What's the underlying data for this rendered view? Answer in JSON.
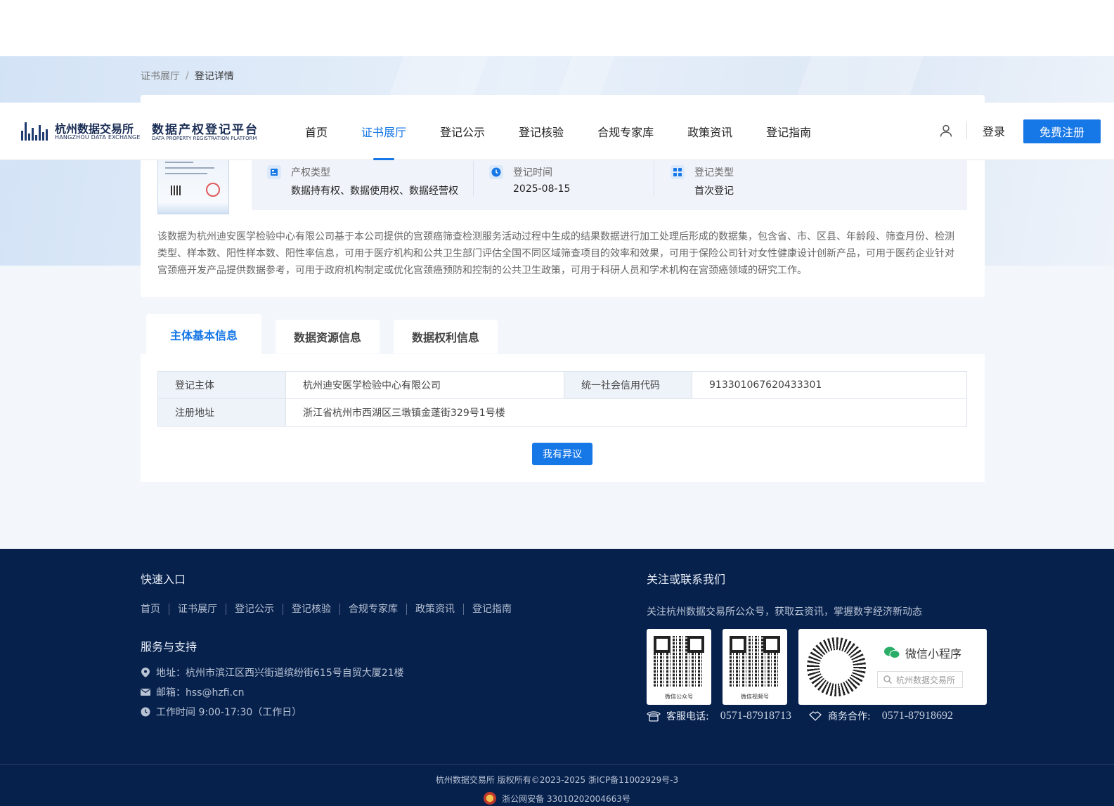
{
  "breadcrumb": {
    "parent": "证书展厅",
    "separator": "/",
    "current": "登记详情"
  },
  "header": {
    "logo_cn": "杭州数据交易所",
    "logo_en": "HANGZHOU DATA EXCHANGE",
    "platform_cn": "数据产权登记平台",
    "platform_en": "DATA PROPERTY REGISTRATION PLATFORM",
    "nav": [
      "首页",
      "证书展厅",
      "登记公示",
      "登记核验",
      "合规专家库",
      "政策资讯",
      "登记指南"
    ],
    "active_nav": "证书展厅",
    "login": "登录",
    "register": "免费注册"
  },
  "detail": {
    "right_type_label": "产权类型",
    "right_type_value": "数据持有权、数据使用权、数据经营权",
    "reg_time_label": "登记时间",
    "reg_time_value": "2025-08-15",
    "reg_kind_label": "登记类型",
    "reg_kind_value": "首次登记",
    "description": "该数据为杭州迪安医学检验中心有限公司基于本公司提供的宫颈癌筛查检测服务活动过程中生成的结果数据进行加工处理后形成的数据集，包含省、市、区县、年龄段、筛查月份、检测类型、样本数、阳性样本数、阳性率信息，可用于医疗机构和公共卫生部门评估全国不同区域筛查项目的效率和效果，可用于保险公司针对女性健康设计创新产品，可用于医药企业针对宫颈癌开发产品提供数据参考，可用于政府机构制定或优化宫颈癌预防和控制的公共卫生政策，可用于科研人员和学术机构在宫颈癌领域的研究工作。"
  },
  "tabs": [
    "主体基本信息",
    "数据资源信息",
    "数据权利信息"
  ],
  "active_tab": "主体基本信息",
  "subject": {
    "entity_label": "登记主体",
    "entity_value": "杭州迪安医学检验中心有限公司",
    "credit_code_label": "统一社会信用代码",
    "credit_code_value": "913301067620433301",
    "address_label": "注册地址",
    "address_value": "浙江省杭州市西湖区三墩镇金蓬街329号1号楼"
  },
  "objection_button": "我有异议",
  "footer": {
    "quick_title": "快速入口",
    "quick_links": [
      "首页",
      "证书展厅",
      "登记公示",
      "登记核验",
      "合规专家库",
      "政策资讯",
      "登记指南"
    ],
    "service_title": "服务与支持",
    "address": "地址：杭州市滨江区西兴街道缤纷街615号自贸大厦21楼",
    "email": "邮箱：hss@hzfi.cn",
    "hours": "工作时间 9:00-17:30（工作日）",
    "follow_title": "关注或联系我们",
    "follow_text": "关注杭州数据交易所公众号，获取云资讯，掌握数字经济新动态",
    "qr_wechat_caption": "微信公众号",
    "qr_video_caption": "微信视频号",
    "mini_program_title": "微信小程序",
    "mini_program_search": "杭州数据交易所",
    "service_phone_label": "客服电话:",
    "service_phone": "0571-87918713",
    "business_label": "商务合作:",
    "business_phone": "0571-87918692",
    "copyright": "杭州数据交易所 版权所有©2023-2025 浙ICP备11002929号-3",
    "beian": "浙公网安备 33010202004663号"
  },
  "colors": {
    "primary": "#1677e6",
    "footer_bg": "#07214d",
    "nav_text": "#222222"
  }
}
